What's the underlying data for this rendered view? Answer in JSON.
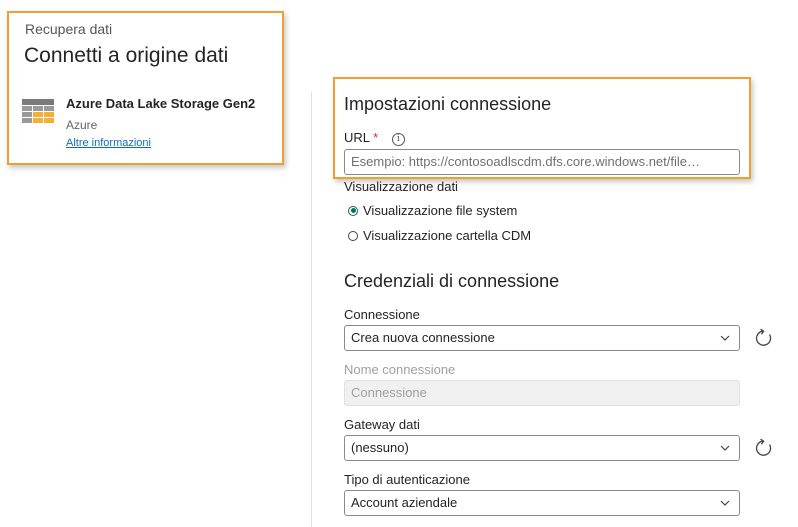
{
  "header": {
    "breadcrumb": "Recupera dati",
    "title": "Connetti a origine dati"
  },
  "connector": {
    "icon": "table-grid-icon",
    "name": "Azure Data Lake Storage Gen2",
    "category": "Azure",
    "more_info_link": "Altre informazioni"
  },
  "connection_settings": {
    "title": "Impostazioni connessione",
    "url_label": "URL",
    "url_required": "*",
    "url_info_icon": "info-icon",
    "url_value": "",
    "url_placeholder": "Esempio: https://contosoadlscdm.dfs.core.windows.net/file…",
    "data_view_label": "Visualizzazione dati",
    "data_view_options": [
      {
        "label": "Visualizzazione file system",
        "selected": true
      },
      {
        "label": "Visualizzazione cartella CDM",
        "selected": false
      }
    ]
  },
  "credentials": {
    "title": "Credenziali di connessione",
    "connection_label": "Connessione",
    "connection_value": "Crea nuova connessione",
    "connection_name_label": "Nome connessione",
    "connection_name_placeholder": "Connessione",
    "gateway_label": "Gateway dati",
    "gateway_value": "(nessuno)",
    "auth_label": "Tipo di autenticazione",
    "auth_value": "Account aziendale"
  },
  "colors": {
    "highlight": "#f0a030",
    "radio_selected": "#0f6b5c",
    "link": "#0f6cbd"
  }
}
